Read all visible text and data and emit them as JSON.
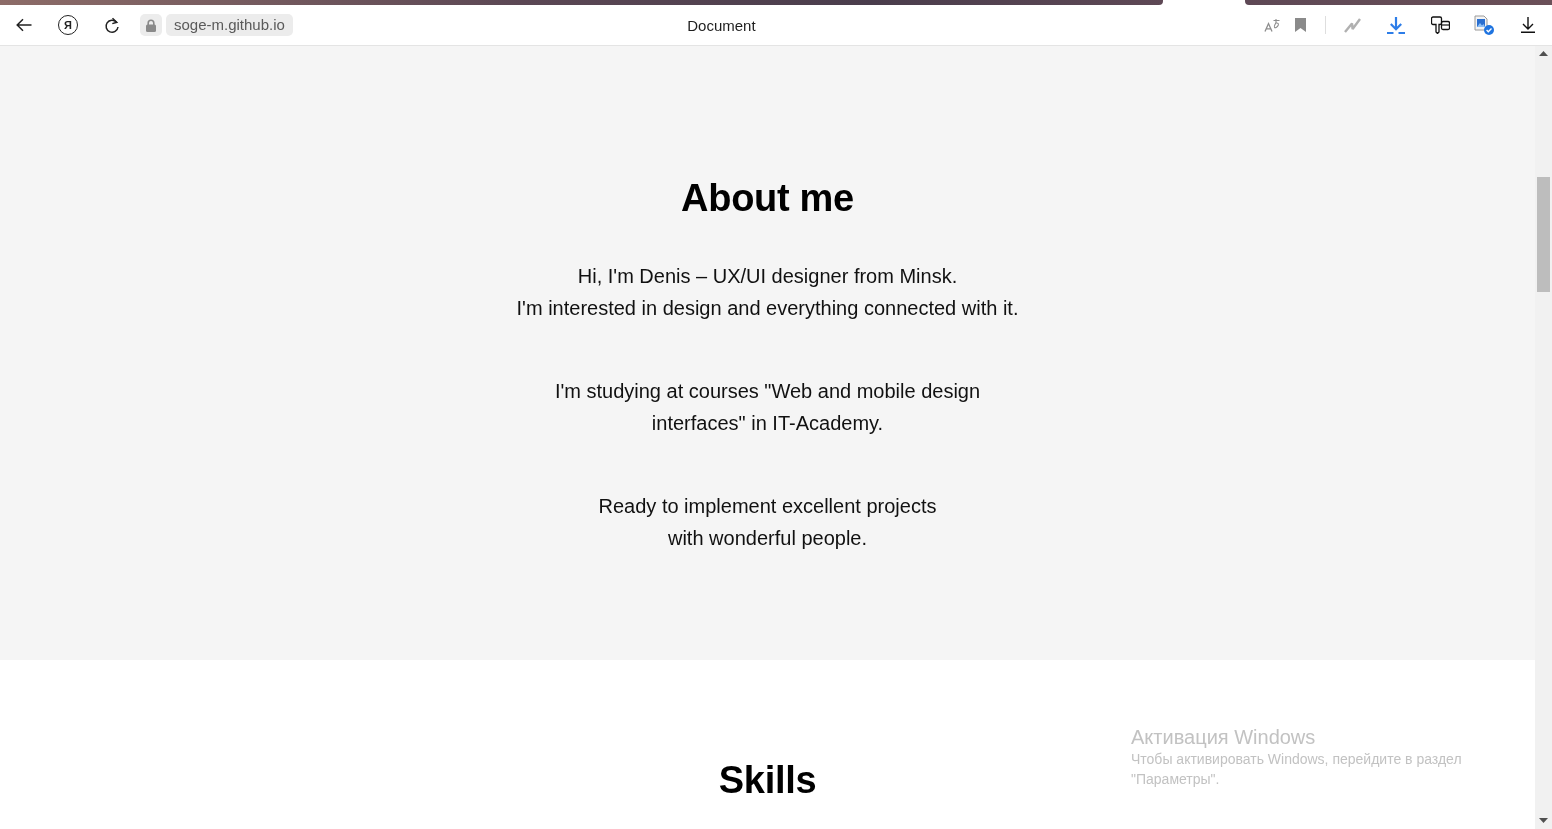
{
  "toolbar": {
    "logo_glyph": "Я",
    "address": "soge-m.github.io",
    "title": "Document"
  },
  "about": {
    "heading": "About me",
    "paragraphs": [
      [
        "Hi, I'm Denis – UX/UI designer from Minsk.",
        "I'm interested in design and everything connected with it."
      ],
      [
        "I'm studying at courses \"Web and mobile design",
        "interfaces\" in IT-Academy."
      ],
      [
        "Ready to implement excellent projects",
        "with wonderful people."
      ]
    ]
  },
  "skills": {
    "heading": "Skills"
  },
  "activation_notice": {
    "title": "Активация Windows",
    "text": "Чтобы активировать Windows, перейдите в раздел \"Параметры\"."
  }
}
